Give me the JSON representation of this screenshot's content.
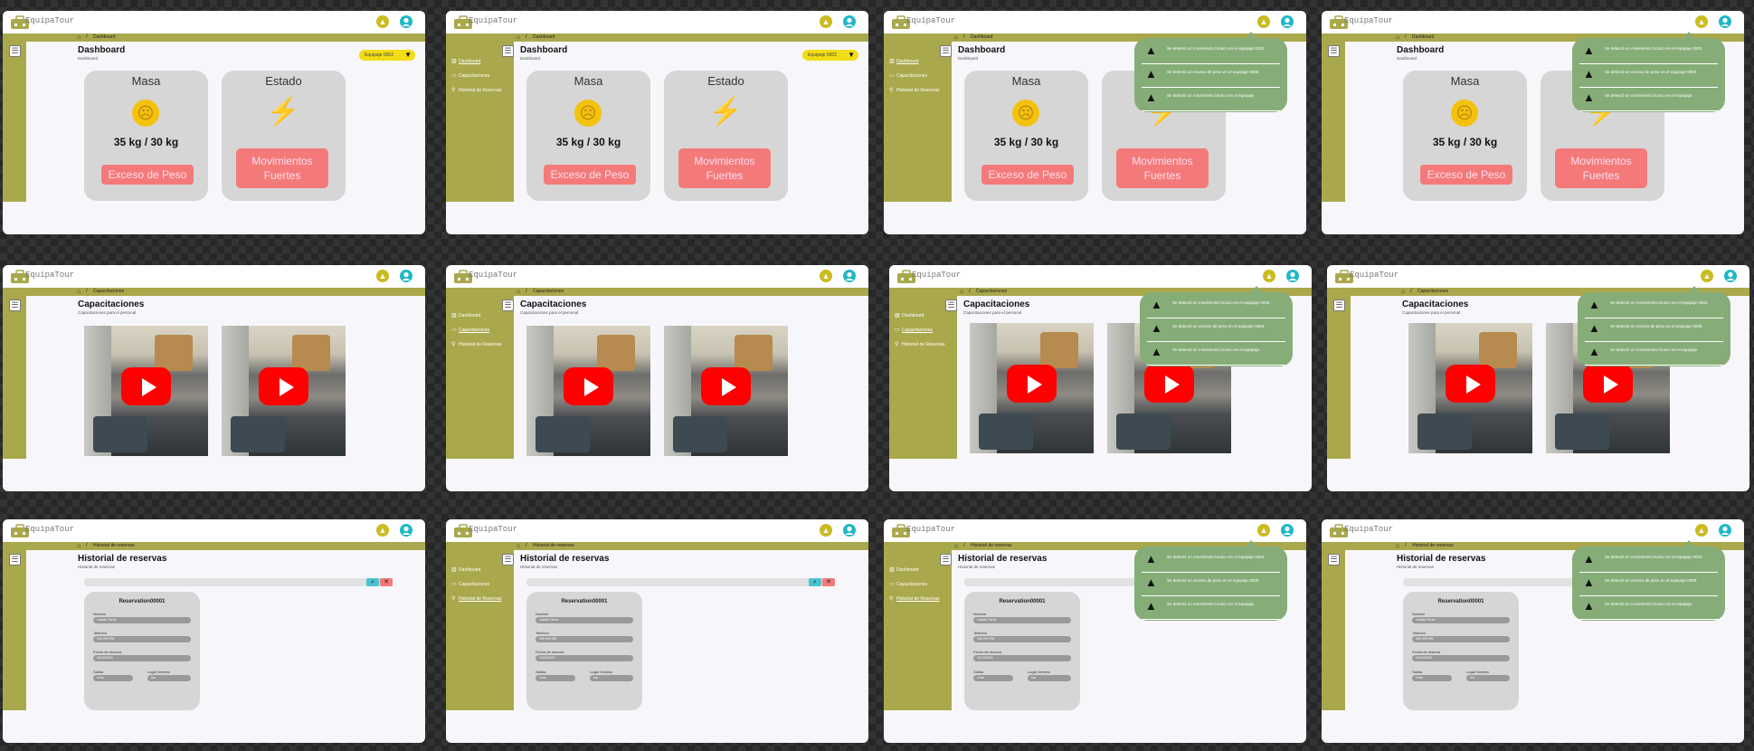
{
  "app": {
    "brand": "EquipaTour",
    "home_icon": "home-icon",
    "crumb_sep": "/",
    "bell_icon": "bell-icon",
    "user_icon": "user-icon",
    "menu_icon": "menu-icon"
  },
  "colors": {
    "olive": "#aaa84c",
    "card": "#d6d6d6",
    "alert": "#f47a7a",
    "yellow": "#f2dc14",
    "notif": "#86ad78",
    "accent": "#20b8c8"
  },
  "sidebar": {
    "items": [
      {
        "label": "Dashboard",
        "icon": "bar-chart-icon"
      },
      {
        "label": "Capacitaciones",
        "icon": "laptop-icon"
      },
      {
        "label": "Historial de Reservas",
        "icon": "sitemap-icon"
      }
    ]
  },
  "dashboard": {
    "crumb": "Dashboard",
    "title": "Dashboard",
    "subtitle": "Dashboard",
    "select_value": "Equipaje 0002",
    "masa_title": "Masa",
    "mood_icon": "sad-face-icon",
    "weight": "35 kg / 30 kg",
    "excess_button": "Exceso de Peso",
    "estado_title": "Estado",
    "bolt_icon": "lightning-icon",
    "movement_button": "Movimientos Fuertes"
  },
  "training": {
    "crumb": "Capacitaciones",
    "title": "Capacitaciones",
    "subtitle": "Capacitaciones para el personal",
    "play_icon": "play-icon"
  },
  "history": {
    "crumb": "Historial de reservas",
    "title": "Historial de reservas",
    "subtitle": "Historial de reservas",
    "search_icon": "search-icon",
    "clear_icon": "close-icon",
    "reservation": {
      "title": "Reservation00001",
      "name_label": "Nombre",
      "name_value": "Juanito Perez",
      "phone_label": "Telefono",
      "phone_value": "999 999 999",
      "date_label": "Fecha de reserva",
      "date_value": "10/10/2020",
      "departure_label": "Salida",
      "departure_value": "Lima",
      "destination_label": "Lugar Destino",
      "destination_value": "Ica"
    }
  },
  "notifications": [
    {
      "text": "Se detectó un movimiento brusco en el equipaje 0002.",
      "icon": "bell-alert-icon"
    },
    {
      "text": "Se detectó un exceso de peso en el equipaje 0008.",
      "icon": "bell-alert-icon"
    },
    {
      "text": "Se detectó un movimiento brusco en el equipaje.",
      "icon": "bell-alert-icon"
    }
  ]
}
